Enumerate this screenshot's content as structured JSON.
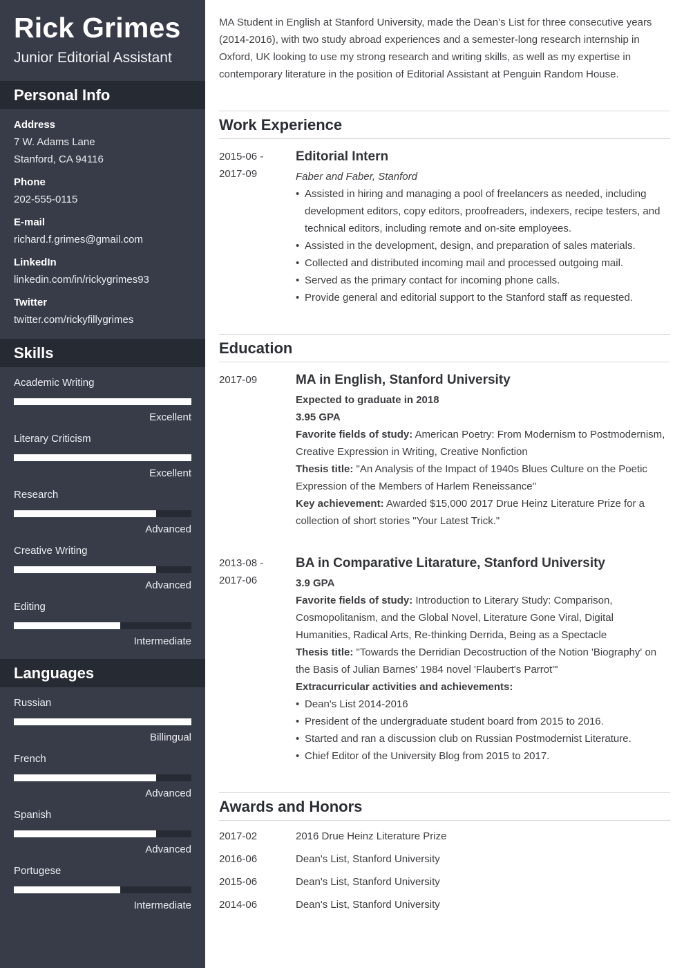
{
  "profile": {
    "name": "Rick Grimes",
    "title": "Junior Editorial Assistant"
  },
  "colors": {
    "sidebar_bg": "#373c48",
    "sidebar_header_bg": "#262a33",
    "bar_fill": "#ffffff",
    "bar_track": "#262a33",
    "divider": "#d6d6d6"
  },
  "personal_info": {
    "heading": "Personal Info",
    "items": [
      {
        "label": "Address",
        "lines": [
          "7 W. Adams Lane",
          "Stanford, CA 94116"
        ]
      },
      {
        "label": "Phone",
        "lines": [
          "202-555-0115"
        ]
      },
      {
        "label": "E-mail",
        "lines": [
          "richard.f.grimes@gmail.com"
        ]
      },
      {
        "label": "LinkedIn",
        "lines": [
          "linkedin.com/in/rickygrimes93"
        ]
      },
      {
        "label": "Twitter",
        "lines": [
          "twitter.com/rickyfillygrimes"
        ]
      }
    ]
  },
  "skills": {
    "heading": "Skills",
    "items": [
      {
        "name": "Academic Writing",
        "level": "Excellent",
        "fraction": 1.0
      },
      {
        "name": "Literary Criticism",
        "level": "Excellent",
        "fraction": 1.0
      },
      {
        "name": "Research",
        "level": "Advanced",
        "fraction": 0.8
      },
      {
        "name": "Creative Writing",
        "level": "Advanced",
        "fraction": 0.8
      },
      {
        "name": "Editing",
        "level": "Intermediate",
        "fraction": 0.6
      }
    ]
  },
  "languages": {
    "heading": "Languages",
    "items": [
      {
        "name": "Russian",
        "level": "Billingual",
        "fraction": 1.0
      },
      {
        "name": "French",
        "level": "Advanced",
        "fraction": 0.8
      },
      {
        "name": "Spanish",
        "level": "Advanced",
        "fraction": 0.8
      },
      {
        "name": "Portugese",
        "level": "Intermediate",
        "fraction": 0.6
      }
    ]
  },
  "summary": "MA Student in English at Stanford University, made the Dean’s List for three consecutive years (2014-2016), with two study abroad experiences and a semester-long research internship in Oxford, UK looking to use my strong research and writing skills, as well as my expertise in contemporary literature in the position of Editorial Assistant at Penguin Random House.",
  "work": {
    "heading": "Work Experience",
    "entries": [
      {
        "date_start": "2015-06 -",
        "date_end": "2017-09",
        "title": "Editorial Intern",
        "company": "Faber and Faber, Stanford",
        "bullets": [
          "Assisted in hiring and managing a pool of freelancers as needed, including development editors, copy editors, proofreaders, indexers, recipe testers, and technical editors, including remote and on-site employees.",
          "Assisted in the development, design, and preparation of sales materials.",
          "Collected and distributed incoming mail and processed outgoing mail.",
          "Served as the primary contact for incoming phone calls.",
          "Provide general and editorial support to the Stanford staff as requested."
        ]
      }
    ]
  },
  "education": {
    "heading": "Education",
    "entries": [
      {
        "date_start": "2017-09",
        "title": "MA in English, Stanford University",
        "expected": "Expected to graduate in 2018",
        "gpa": "3.95 GPA",
        "fields_label": "Favorite fields of study:",
        "fields": "American Poetry: From Modernism to Postmodernism, Creative Expression in Writing, Creative Nonfiction",
        "thesis_label": "Thesis title:",
        "thesis": "\"An Analysis of the Impact of 1940s Blues Culture on the Poetic Expression of the Members of Harlem Reneissance\"",
        "achievement_label": "Key achievement:",
        "achievement": "Awarded $15,000 2017 Drue Heinz Literature Prize for a collection of short stories \"Your Latest Trick.\""
      },
      {
        "date_start": "2013-08 -",
        "date_end": "2017-06",
        "title": "BA in Comparative Litarature, Stanford University",
        "gpa": "3.9 GPA",
        "fields_label": "Favorite fields of study:",
        "fields": "Introduction to Literary Study: Comparison, Cosmopolitanism, and the Global Novel, Literature Gone Viral, Digital Humanities, Radical Arts, Re-thinking Derrida, Being as a Spectacle",
        "thesis_label": "Thesis title:",
        "thesis": "\"Towards the Derridian Decostruction of the Notion 'Biography' on the Basis of Julian Barnes' 1984 novel 'Flaubert's Parrot'\"",
        "extra_label": "Extracurricular activities and achievements:",
        "bullets": [
          "Dean's List 2014-2016",
          "President of the undergraduate student board from 2015 to 2016.",
          "Started and ran a discussion club on Russian Postmodernist Literature.",
          "Chief Editor of the University Blog from 2015 to 2017."
        ]
      }
    ]
  },
  "awards": {
    "heading": "Awards and Honors",
    "items": [
      {
        "date": "2017-02",
        "text": "2016 Drue Heinz Literature Prize"
      },
      {
        "date": "2016-06",
        "text": "Dean's List, Stanford University"
      },
      {
        "date": "2015-06",
        "text": "Dean's List, Stanford University"
      },
      {
        "date": "2014-06",
        "text": "Dean's List, Stanford University"
      }
    ]
  }
}
